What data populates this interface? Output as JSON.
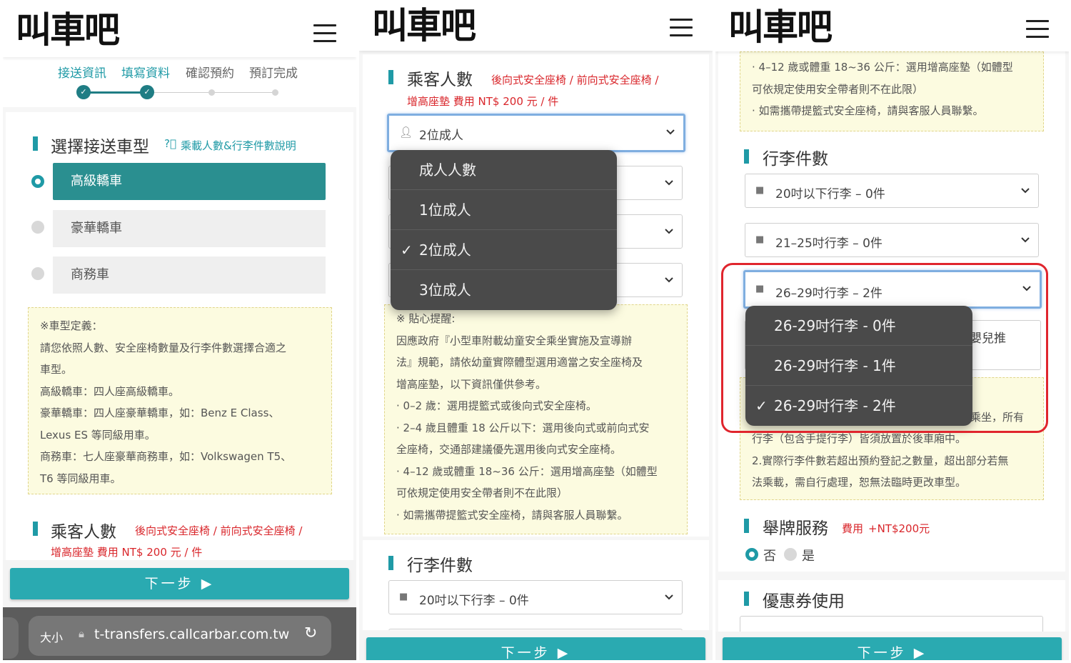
{
  "logo_text": "叫車吧",
  "panel1": {
    "steps": [
      "接送資訊",
      "填寫資料",
      "確認預約",
      "預訂完成"
    ],
    "car_section_title": "選擇接送車型",
    "car_help_link": "乘載人數&行李件數說明",
    "car_options": [
      "高級轎車",
      "豪華轎車",
      "商務車"
    ],
    "selected_car": "高級轎車",
    "car_note_lines": [
      "※車型定義：",
      "請您依照人數、安全座椅數量及行李件數選擇合適之",
      "車型。",
      "高級轎車：四人座高級轎車。",
      "豪華轎車：四人座豪華轎車，如：Benz E Class、",
      "Lexus ES 等同級用車。",
      "商務車：七人座豪華商務車，如：Volkswagen T5、",
      "T6 等同級用車。"
    ],
    "passenger_title": "乘客人數",
    "passenger_fee_line1": "後向式安全座椅 / 前向式安全座椅 /",
    "passenger_fee_line2": "增高座墊 費用 NT$ 200 元 / 件",
    "next_label": "下一步 ▶",
    "browser": {
      "text_size": "大小",
      "url": "t-transfers.callcarbar.com.tw"
    }
  },
  "panel2": {
    "passenger_title": "乘客人數",
    "passenger_fee_line1": "後向式安全座椅 / 前向式安全座椅 /",
    "passenger_fee_line2": "增高座墊 費用 NT$ 200 元 / 件",
    "adult_select_value": "2位成人",
    "adult_dropdown": {
      "header": "成人人數",
      "options": [
        "1位成人",
        "2位成人",
        "3位成人"
      ],
      "selected": "2位成人"
    },
    "tip_lines": [
      "※ 貼心提醒:",
      "因應政府『小型車附載幼童安全乘坐實施及宣導辦",
      "法』規範，請依幼童實際體型選用適當之安全座椅及",
      "增高座墊，以下資訊僅供參考。",
      "‧ 0–2 歲：選用提籃式或後向式安全座椅。",
      "‧ 2–4 歲且體重 18 公斤以下：選用後向式或前向式安",
      "全座椅，交通部建議優先選用後向式安全座椅。",
      "‧ 4–12 歲或體重 18~36 公斤：選用增高座墊（如體型",
      "可依規定使用安全帶者則不在此限）",
      "‧ 如需攜帶提籃式安全座椅，請與客服人員聯繫。"
    ],
    "luggage_title": "行李件數",
    "luggage_first_select": "20吋以下行李 – 0件",
    "next_label": "下一步 ▶"
  },
  "panel3": {
    "top_note_lines": [
      "‧ 4–12 歲或體重 18~36 公斤：選用增高座墊（如體型",
      "可依規定使用安全帶者則不在此限）",
      "‧ 如需攜帶提籃式安全座椅，請與客服人員聯繫。"
    ],
    "luggage_title": "行李件數",
    "luggage_selects": [
      "20吋以下行李 – 0件",
      "21–25吋行李 – 0件",
      "26–29吋行李 – 2件"
    ],
    "luggage_dropdown": {
      "options": [
        "26-29吋行李 - 0件",
        "26-29吋行李 - 1件",
        "26-29吋行李 - 2件"
      ],
      "selected": "26-29吋行李 - 2件"
    },
    "partial_text_stroller": "嬰兒推",
    "partial_text_ride": "乘坐，所有",
    "bottom_note_lines": [
      "行李（包含手提行李）皆須放置於後車廂中。",
      "2.實際行李件數若超出預約登記之數量，超出部分若無",
      "法乘載，需自行處理，恕無法臨時更改車型。"
    ],
    "sign_title": "舉牌服務",
    "sign_fee_label": "費用",
    "sign_fee_amount": "+NT$200元",
    "sign_no": "否",
    "sign_yes": "是",
    "coupon_title": "優惠券使用",
    "next_label": "下一步 ▶"
  },
  "colors": {
    "teal": "#1f9aa6",
    "button": "#2aaab1",
    "red": "#d9262b",
    "note_bg": "#fcfbe0",
    "dropdown_bg": "#4a4a4a"
  }
}
